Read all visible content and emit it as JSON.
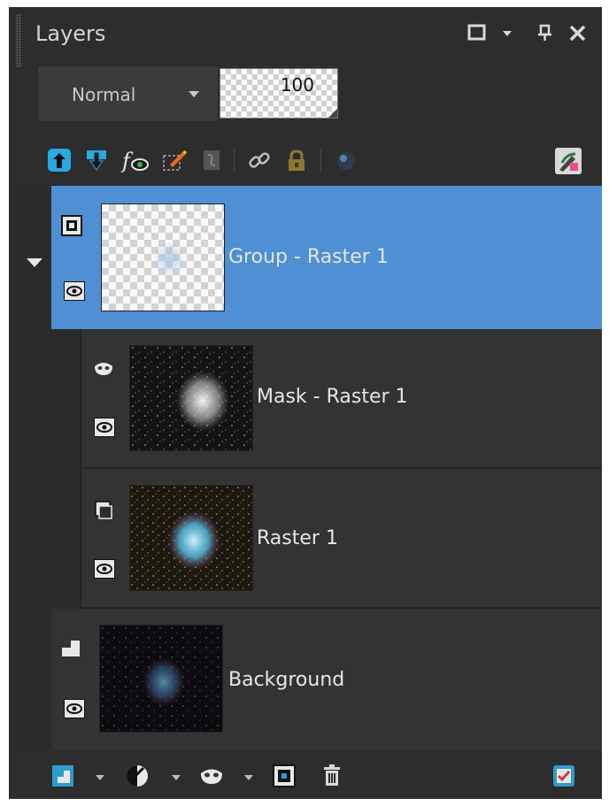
{
  "panel": {
    "title": "Layers",
    "blend_mode": "Normal",
    "opacity": "100"
  },
  "layers": [
    {
      "name": "Group - Raster 1",
      "type": "group",
      "selected": true
    },
    {
      "name": "Mask - Raster 1",
      "type": "mask",
      "selected": false
    },
    {
      "name": "Raster 1",
      "type": "raster",
      "selected": false
    },
    {
      "name": "Background",
      "type": "background",
      "selected": false
    }
  ],
  "colors": {
    "panel_bg": "#2d2d2d",
    "row_bg": "#333333",
    "selection": "#4f8fd4",
    "text": "#e6e6e6"
  }
}
